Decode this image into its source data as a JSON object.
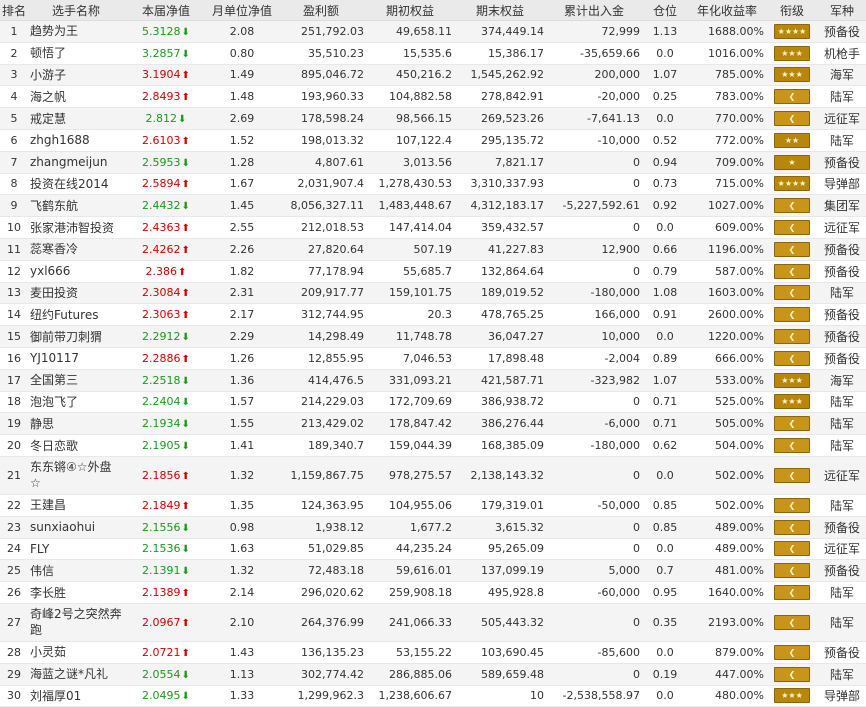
{
  "headers": [
    "排名",
    "选手名称",
    "本届净值",
    "月单位净值",
    "盈利额",
    "期初权益",
    "期末权益",
    "累计出入金",
    "仓位",
    "年化收益率",
    "衔级",
    "军种"
  ],
  "rows": [
    {
      "rank": "1",
      "name": "趋势为王",
      "nav": "5.3128",
      "dir": "down",
      "month": "2.08",
      "profit": "251,792.03",
      "start": "49,658.11",
      "end": "374,449.14",
      "flow": "72,999",
      "pos": "1.13",
      "annual": "1688.00%",
      "insignia": "four-dot",
      "army": "预备役"
    },
    {
      "rank": "2",
      "name": "顿悟了",
      "nav": "3.2857",
      "dir": "down",
      "month": "0.80",
      "profit": "35,510.23",
      "start": "15,535.6",
      "end": "15,386.17",
      "flow": "-35,659.66",
      "pos": "0.0",
      "annual": "1016.00%",
      "insignia": "three-dot",
      "army": "机枪手"
    },
    {
      "rank": "3",
      "name": "小游子",
      "nav": "3.1904",
      "dir": "up",
      "month": "1.49",
      "profit": "895,046.72",
      "start": "450,216.2",
      "end": "1,545,262.92",
      "flow": "200,000",
      "pos": "1.07",
      "annual": "785.00%",
      "insignia": "three-dot",
      "army": "海军"
    },
    {
      "rank": "4",
      "name": "海之帆",
      "nav": "2.8493",
      "dir": "up",
      "month": "1.48",
      "profit": "193,960.33",
      "start": "104,882.58",
      "end": "278,842.91",
      "flow": "-20,000",
      "pos": "0.25",
      "annual": "783.00%",
      "insignia": "chevron",
      "army": "陆军"
    },
    {
      "rank": "5",
      "name": "戒定慧",
      "nav": "2.812",
      "dir": "down",
      "month": "2.69",
      "profit": "178,598.24",
      "start": "98,566.15",
      "end": "269,523.26",
      "flow": "-7,641.13",
      "pos": "0.0",
      "annual": "770.00%",
      "insignia": "chevron",
      "army": "远征军"
    },
    {
      "rank": "6",
      "name": "zhgh1688",
      "nav": "2.6103",
      "dir": "up",
      "month": "1.52",
      "profit": "198,013.32",
      "start": "107,122.4",
      "end": "295,135.72",
      "flow": "-10,000",
      "pos": "0.52",
      "annual": "772.00%",
      "insignia": "two-dot",
      "army": "陆军"
    },
    {
      "rank": "7",
      "name": "zhangmeijun",
      "nav": "2.5953",
      "dir": "down",
      "month": "1.28",
      "profit": "4,807.61",
      "start": "3,013.56",
      "end": "7,821.17",
      "flow": "0",
      "pos": "0.94",
      "annual": "709.00%",
      "insignia": "one-dot",
      "army": "预备役"
    },
    {
      "rank": "8",
      "name": "投资在线2014",
      "nav": "2.5894",
      "dir": "up",
      "month": "1.67",
      "profit": "2,031,907.4",
      "start": "1,278,430.53",
      "end": "3,310,337.93",
      "flow": "0",
      "pos": "0.73",
      "annual": "715.00%",
      "insignia": "four-dot",
      "army": "导弹部"
    },
    {
      "rank": "9",
      "name": "飞鹤东航",
      "nav": "2.4432",
      "dir": "down",
      "month": "1.45",
      "profit": "8,056,327.11",
      "start": "1,483,448.67",
      "end": "4,312,183.17",
      "flow": "-5,227,592.61",
      "pos": "0.92",
      "annual": "1027.00%",
      "insignia": "chevron",
      "army": "集团军"
    },
    {
      "rank": "10",
      "name": "张家港沛智投资",
      "nav": "2.4363",
      "dir": "up",
      "month": "2.55",
      "profit": "212,018.53",
      "start": "147,414.04",
      "end": "359,432.57",
      "flow": "0",
      "pos": "0.0",
      "annual": "609.00%",
      "insignia": "chevron",
      "army": "远征军"
    },
    {
      "rank": "11",
      "name": "蕊寒香冷",
      "nav": "2.4262",
      "dir": "up",
      "month": "2.26",
      "profit": "27,820.64",
      "start": "507.19",
      "end": "41,227.83",
      "flow": "12,900",
      "pos": "0.66",
      "annual": "1196.00%",
      "insignia": "chevron",
      "army": "预备役"
    },
    {
      "rank": "12",
      "name": "yxl666",
      "nav": "2.386",
      "dir": "up",
      "month": "1.82",
      "profit": "77,178.94",
      "start": "55,685.7",
      "end": "132,864.64",
      "flow": "0",
      "pos": "0.79",
      "annual": "587.00%",
      "insignia": "chevron",
      "army": "预备役"
    },
    {
      "rank": "13",
      "name": "麦田投资",
      "nav": "2.3084",
      "dir": "up",
      "month": "2.31",
      "profit": "209,917.77",
      "start": "159,101.75",
      "end": "189,019.52",
      "flow": "-180,000",
      "pos": "1.08",
      "annual": "1603.00%",
      "insignia": "chevron",
      "army": "陆军"
    },
    {
      "rank": "14",
      "name": "纽约Futures",
      "nav": "2.3063",
      "dir": "up",
      "month": "2.17",
      "profit": "312,744.95",
      "start": "20.3",
      "end": "478,765.25",
      "flow": "166,000",
      "pos": "0.91",
      "annual": "2600.00%",
      "insignia": "chevron",
      "army": "预备役"
    },
    {
      "rank": "15",
      "name": "御前带刀刺猬",
      "nav": "2.2912",
      "dir": "down",
      "month": "2.29",
      "profit": "14,298.49",
      "start": "11,748.78",
      "end": "36,047.27",
      "flow": "10,000",
      "pos": "0.0",
      "annual": "1220.00%",
      "insignia": "chevron",
      "army": "预备役"
    },
    {
      "rank": "16",
      "name": "YJ10117",
      "nav": "2.2886",
      "dir": "up",
      "month": "1.26",
      "profit": "12,855.95",
      "start": "7,046.53",
      "end": "17,898.48",
      "flow": "-2,004",
      "pos": "0.89",
      "annual": "666.00%",
      "insignia": "chevron",
      "army": "预备役"
    },
    {
      "rank": "17",
      "name": "全国第三",
      "nav": "2.2518",
      "dir": "down",
      "month": "1.36",
      "profit": "414,476.5",
      "start": "331,093.21",
      "end": "421,587.71",
      "flow": "-323,982",
      "pos": "1.07",
      "annual": "533.00%",
      "insignia": "three-dot",
      "army": "海军"
    },
    {
      "rank": "18",
      "name": "泡泡飞了",
      "nav": "2.2404",
      "dir": "down",
      "month": "1.57",
      "profit": "214,229.03",
      "start": "172,709.69",
      "end": "386,938.72",
      "flow": "0",
      "pos": "0.71",
      "annual": "525.00%",
      "insignia": "three-dot",
      "army": "陆军"
    },
    {
      "rank": "19",
      "name": "静思",
      "nav": "2.1934",
      "dir": "down",
      "month": "1.55",
      "profit": "213,429.02",
      "start": "178,847.42",
      "end": "386,276.44",
      "flow": "-6,000",
      "pos": "0.71",
      "annual": "505.00%",
      "insignia": "chevron",
      "army": "陆军"
    },
    {
      "rank": "20",
      "name": "冬日恋歌",
      "nav": "2.1905",
      "dir": "down",
      "month": "1.41",
      "profit": "189,340.7",
      "start": "159,044.39",
      "end": "168,385.09",
      "flow": "-180,000",
      "pos": "0.62",
      "annual": "504.00%",
      "insignia": "chevron",
      "army": "陆军"
    },
    {
      "rank": "21",
      "name": "东东锵④☆外盘☆",
      "nav": "2.1856",
      "dir": "up",
      "month": "1.32",
      "profit": "1,159,867.75",
      "start": "978,275.57",
      "end": "2,138,143.32",
      "flow": "0",
      "pos": "0.0",
      "annual": "502.00%",
      "insignia": "chevron",
      "army": "远征军",
      "tall": true
    },
    {
      "rank": "22",
      "name": "王建昌",
      "nav": "2.1849",
      "dir": "up",
      "month": "1.35",
      "profit": "124,363.95",
      "start": "104,955.06",
      "end": "179,319.01",
      "flow": "-50,000",
      "pos": "0.85",
      "annual": "502.00%",
      "insignia": "chevron",
      "army": "陆军"
    },
    {
      "rank": "23",
      "name": "sunxiaohui",
      "nav": "2.1556",
      "dir": "down",
      "month": "0.98",
      "profit": "1,938.12",
      "start": "1,677.2",
      "end": "3,615.32",
      "flow": "0",
      "pos": "0.85",
      "annual": "489.00%",
      "insignia": "chevron",
      "army": "预备役"
    },
    {
      "rank": "24",
      "name": "FLY",
      "nav": "2.1536",
      "dir": "down",
      "month": "1.63",
      "profit": "51,029.85",
      "start": "44,235.24",
      "end": "95,265.09",
      "flow": "0",
      "pos": "0.0",
      "annual": "489.00%",
      "insignia": "chevron",
      "army": "远征军"
    },
    {
      "rank": "25",
      "name": "伟信",
      "nav": "2.1391",
      "dir": "down",
      "month": "1.32",
      "profit": "72,483.18",
      "start": "59,616.01",
      "end": "137,099.19",
      "flow": "5,000",
      "pos": "0.7",
      "annual": "481.00%",
      "insignia": "chevron",
      "army": "预备役"
    },
    {
      "rank": "26",
      "name": "李长胜",
      "nav": "2.1389",
      "dir": "up",
      "month": "2.14",
      "profit": "296,020.62",
      "start": "259,908.18",
      "end": "495,928.8",
      "flow": "-60,000",
      "pos": "0.95",
      "annual": "1640.00%",
      "insignia": "chevron",
      "army": "陆军"
    },
    {
      "rank": "27",
      "name": "奇峰2号之突然奔跑",
      "nav": "2.0967",
      "dir": "up",
      "month": "2.10",
      "profit": "264,376.99",
      "start": "241,066.33",
      "end": "505,443.32",
      "flow": "0",
      "pos": "0.35",
      "annual": "2193.00%",
      "insignia": "chevron",
      "army": "陆军",
      "tall": true
    },
    {
      "rank": "28",
      "name": "小灵茹",
      "nav": "2.0721",
      "dir": "up",
      "month": "1.43",
      "profit": "136,135.23",
      "start": "53,155.22",
      "end": "103,690.45",
      "flow": "-85,600",
      "pos": "0.0",
      "annual": "879.00%",
      "insignia": "chevron",
      "army": "预备役"
    },
    {
      "rank": "29",
      "name": "海蓝之谜*凡礼",
      "nav": "2.0554",
      "dir": "down",
      "month": "1.13",
      "profit": "302,774.42",
      "start": "286,885.06",
      "end": "589,659.48",
      "flow": "0",
      "pos": "0.19",
      "annual": "447.00%",
      "insignia": "chevron",
      "army": "陆军"
    },
    {
      "rank": "30",
      "name": "刘福厚01",
      "nav": "2.0495",
      "dir": "down",
      "month": "1.33",
      "profit": "1,299,962.3",
      "start": "1,238,606.67",
      "end": "10",
      "flow": "-2,538,558.97",
      "pos": "0.0",
      "annual": "480.00%",
      "insignia": "three-dot",
      "army": "导弹部"
    }
  ]
}
